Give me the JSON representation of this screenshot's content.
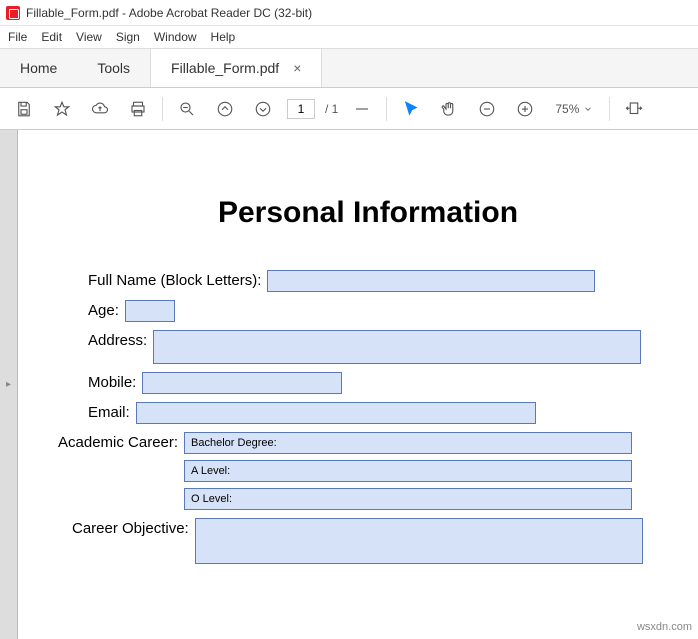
{
  "window": {
    "title": "Fillable_Form.pdf - Adobe Acrobat Reader DC (32-bit)"
  },
  "menu": {
    "file": "File",
    "edit": "Edit",
    "view": "View",
    "sign": "Sign",
    "window": "Window",
    "help": "Help"
  },
  "tabs": {
    "home": "Home",
    "tools": "Tools",
    "doc": "Fillable_Form.pdf"
  },
  "toolbar": {
    "page_current": "1",
    "page_total": "/  1",
    "zoom": "75%"
  },
  "doc": {
    "heading": "Personal Information",
    "labels": {
      "fullname": "Full Name (Block Letters):",
      "age": "Age:",
      "address": "Address:",
      "mobile": "Mobile:",
      "email": "Email:",
      "academic": "Academic Career:",
      "objective": "Career Objective:"
    },
    "academic_items": {
      "bachelor": "Bachelor Degree:",
      "alevel": "A Level:",
      "olevel": "O Level:"
    }
  },
  "watermark": "wsxdn.com"
}
